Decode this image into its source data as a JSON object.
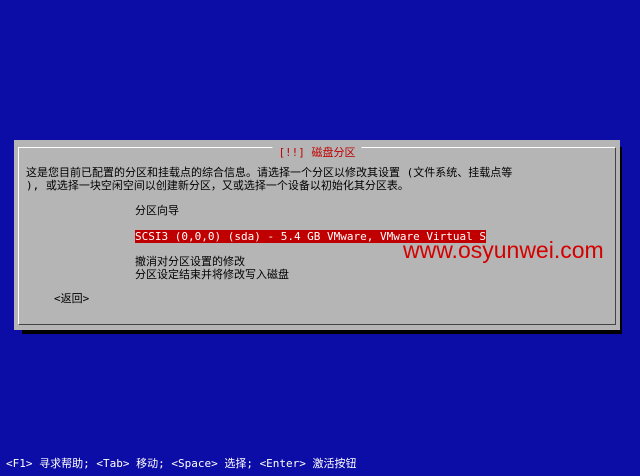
{
  "dialog": {
    "title": "[!!] 磁盘分区",
    "intro_line1": "这是您目前已配置的分区和挂载点的综合信息。请选择一个分区以修改其设置 (文件系统、挂载点等",
    "intro_line2": "), 或选择一块空闲空间以创建新分区，又或选择一个设备以初始化其分区表。",
    "menu": {
      "guided": "分区向导",
      "disk": "SCSI3 (0,0,0) (sda) - 5.4 GB VMware, VMware Virtual S",
      "undo": "撤消对分区设置的修改",
      "finish": "分区设定结束并将修改写入磁盘"
    },
    "back": "<返回>"
  },
  "watermark": "www.osyunwei.com",
  "footer": "<F1> 寻求帮助; <Tab> 移动; <Space> 选择; <Enter> 激活按钮",
  "colors": {
    "background": "#0c0ca6",
    "dialog": "#b5b5b5",
    "highlight": "#c00000",
    "title": "#c00000",
    "watermark": "#d40000"
  }
}
